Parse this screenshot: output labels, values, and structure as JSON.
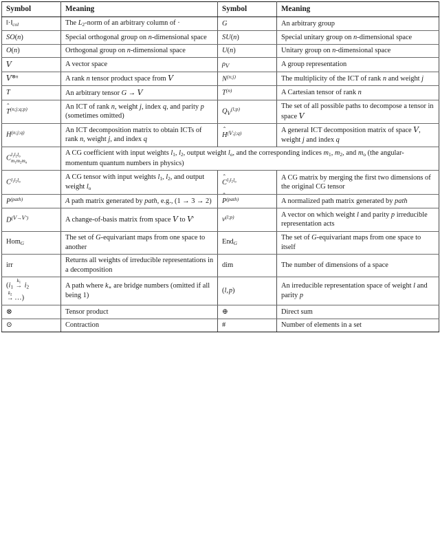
{
  "headers": {
    "symbol": "Symbol",
    "meaning": "Meaning"
  },
  "rows": [
    {
      "left_symbol": "‖·‖_col",
      "left_meaning": "The L₂-norm of an arbitrary column of ·",
      "right_symbol": "G",
      "right_meaning": "An arbitrary group"
    },
    {
      "left_symbol": "SO(n)",
      "left_meaning": "Special orthogonal group on n-dimensional space",
      "right_symbol": "SU(n)",
      "right_meaning": "Special unitary group on n-dimensional space"
    },
    {
      "left_symbol": "O(n)",
      "left_meaning": "Orthogonal group on n-dimensional space",
      "right_symbol": "U(n)",
      "right_meaning": "Unitary group on n-dimensional space"
    },
    {
      "left_symbol": "𝒱",
      "left_meaning": "A vector space",
      "right_symbol": "ρ_𝒱",
      "right_meaning": "A group representation"
    },
    {
      "left_symbol": "𝒱^{⊗n}",
      "left_meaning": "A rank n tensor product space from 𝒱",
      "right_symbol": "N^{(n;j)}",
      "right_meaning": "The multiplicity of the ICT of rank n and weight j"
    },
    {
      "left_symbol": "T",
      "left_meaning": "An arbitrary tensor G → 𝒱",
      "right_symbol": "T^{(n)}",
      "right_meaning": "A Cartesian tensor of rank n"
    },
    {
      "left_symbol": "T̂^{(n;j;q;p)}",
      "left_meaning": "An ICT of rank n, weight j, index q, and parity p (sometimes omitted)",
      "right_symbol": "Q_𝒱^{(l;p)}",
      "right_meaning": "The set of all possible paths to decompose a tensor in space 𝒱"
    },
    {
      "left_symbol": "H^{(n;j;q)}",
      "left_meaning": "An ICT decomposition matrix to obtain ICTs of rank n, weight j, and index q",
      "right_symbol": "Ĥ^{(𝒱;j;q)}",
      "right_meaning": "A general ICT decomposition matrix of space 𝒱, weight j and index q"
    },
    {
      "left_symbol": "C^{l₁l₂lₒ}_{m₁m₂mₒ}",
      "left_meaning": "A CG coefficient with input weights l₁, l₂, output weight lₒ, and the corresponding indices m₁, m₂, and mₒ (the angular-momentum quantum numbers in physics)",
      "spans": true
    },
    {
      "left_symbol": "C^{l₁l₂lₒ}",
      "left_meaning": "A CG tensor with input weights l₁, l₂, and output weight lₒ",
      "right_symbol": "Ĉ^{l₁l₂lₒ}",
      "right_meaning": "A CG matrix by merging the first two dimensions of the original CG tensor"
    },
    {
      "left_symbol": "P^{(path)}",
      "left_meaning": "A path matrix generated by path, e.g., (1 → 3 → 2)",
      "right_symbol": "P̂^{(path)}",
      "right_meaning": "A normalized path matrix generated by path"
    },
    {
      "left_symbol": "D^{(𝒱→𝒱′)}",
      "left_meaning": "A change-of-basis matrix from space 𝒱 to 𝒱′",
      "right_symbol": "v^{(l;p)}",
      "right_meaning": "A vector on which weight l and parity p irreducible representation acts"
    },
    {
      "left_symbol": "Hom_G",
      "left_meaning": "The set of G-equivariant maps from one space to another",
      "right_symbol": "End_G",
      "right_meaning": "The set of G-equivariant maps from one space to itself"
    },
    {
      "left_symbol": "irr",
      "left_meaning": "Returns all weights of irreducible representations in a decomposition",
      "right_symbol": "dim",
      "right_meaning": "The number of dimensions of a space"
    },
    {
      "left_symbol": "(i₁ --k₁--> i₂ --k₂--> …)",
      "left_meaning": "A path where k∗ are bridge numbers (omitted if all being 1)",
      "right_symbol": "(l, p)",
      "right_meaning": "An irreducible representation space of weight l and parity p"
    },
    {
      "left_symbol": "⊗",
      "left_meaning": "Tensor product",
      "right_symbol": "⊕",
      "right_meaning": "Direct sum"
    },
    {
      "left_symbol": "⊙",
      "left_meaning": "Contraction",
      "right_symbol": "#",
      "right_meaning": "Number of elements in a set"
    }
  ]
}
